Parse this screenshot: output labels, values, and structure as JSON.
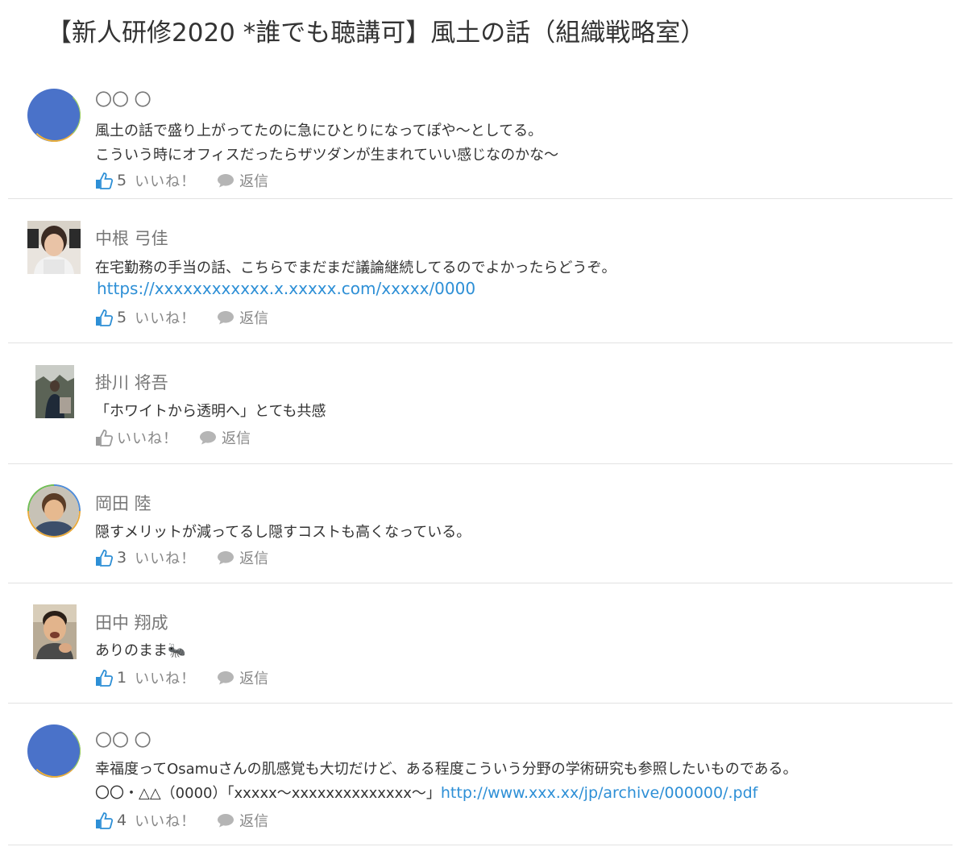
{
  "thread": {
    "title": "【新人研修2020 *誰でも聴講可】風土の話（組織戦略室）"
  },
  "colors": {
    "like_active": "#2d8fd6",
    "like_inactive": "#9a9a9a",
    "link": "#2d8fd6",
    "placeholder_avatar": "#4a72c9"
  },
  "icons": {
    "like": "thumbs-up-icon",
    "reply": "speech-bubble-icon"
  },
  "comments": [
    {
      "author": "〇〇 〇",
      "lines": [
        "風土の話で盛り上がってたのに急にひとりになってぽや〜としてる。",
        "こういう時にオフィスだったらザツダンが生まれていい感じなのかな〜"
      ],
      "like_count": "5",
      "like_label": "いいね！",
      "reply_label": "返信"
    },
    {
      "author": "中根 弓佳",
      "lines": [
        "在宅勤務の手当の話、こちらでまだまだ議論継続してるのでよかったらどうぞ。"
      ],
      "link": "https://xxxxxxxxxxxx.x.xxxxx.com/xxxxx/0000",
      "like_count": "5",
      "like_label": "いいね！",
      "reply_label": "返信"
    },
    {
      "author": "掛川 将吾",
      "lines": [
        "「ホワイトから透明へ」とても共感"
      ],
      "like_count": "",
      "like_label": "いいね！",
      "reply_label": "返信"
    },
    {
      "author": "岡田 陸",
      "lines": [
        "隠すメリットが減ってるし隠すコストも高くなっている。"
      ],
      "like_count": "3",
      "like_label": "いいね！",
      "reply_label": "返信"
    },
    {
      "author": "田中 翔成",
      "lines": [
        "ありのまま🐜"
      ],
      "like_count": "1",
      "like_label": "いいね！",
      "reply_label": "返信"
    },
    {
      "author": "〇〇 〇",
      "lines": [
        "幸福度ってOsamuさんの肌感覚も大切だけど、ある程度こういう分野の学術研究も参照したいものである。"
      ],
      "citation_text": "〇〇・△△（0000）「xxxxx〜xxxxxxxxxxxxxx〜」",
      "citation_link": "http://www.xxx.xx/jp/archive/000000/.pdf",
      "like_count": "4",
      "like_label": "いいね！",
      "reply_label": "返信"
    }
  ]
}
